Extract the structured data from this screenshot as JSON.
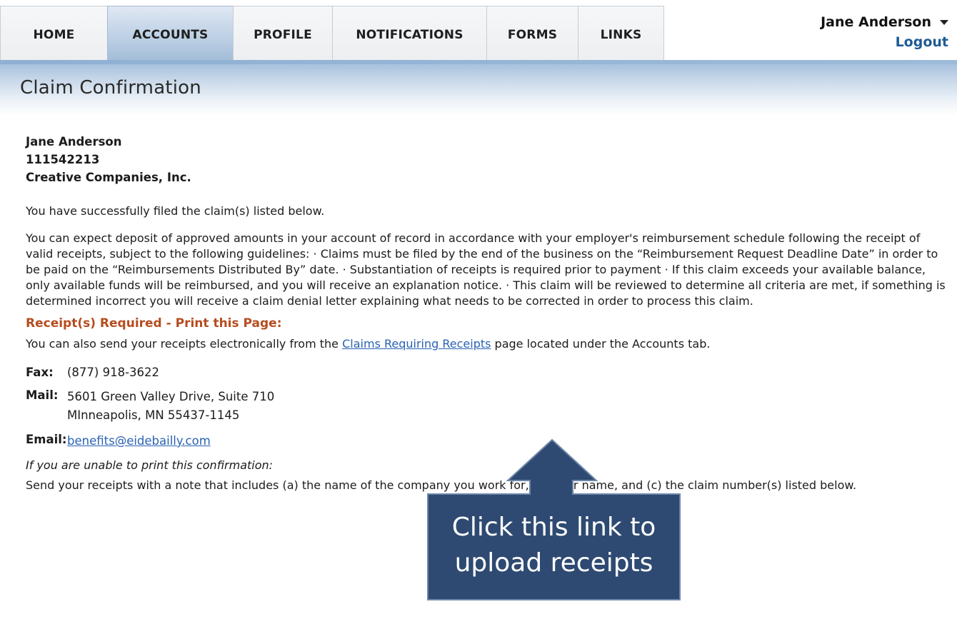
{
  "nav": {
    "tabs": [
      {
        "label": "HOME"
      },
      {
        "label": "ACCOUNTS",
        "active": true
      },
      {
        "label": "PROFILE"
      },
      {
        "label": "NOTIFICATIONS"
      },
      {
        "label": "FORMS"
      },
      {
        "label": "LINKS"
      }
    ],
    "user_name": "Jane Anderson",
    "logout_label": "Logout"
  },
  "page": {
    "title": "Claim Confirmation"
  },
  "participant": {
    "name": "Jane Anderson",
    "id": "111542213",
    "company": "Creative Companies, Inc."
  },
  "messages": {
    "success": "You have successfully filed the claim(s) listed below.",
    "guidelines": "You can expect deposit of approved amounts in your account of record in accordance with your employer's reimbursement schedule following the receipt of valid receipts, subject to the following guidelines: · Claims must be filed by the end of the business on the “Reimbursement Request Deadline Date” in order to be paid on the “Reimbursements Distributed By” date. · Substantiation of receipts is required prior to payment · If this claim exceeds your available balance, only available funds will be reimbursed, and you will receive an explanation notice. · This claim will be reviewed to determine all criteria are met, if something is determined incorrect you will receive a claim denial letter explaining what needs to be corrected in order to process this claim."
  },
  "receipts": {
    "heading": "Receipt(s) Required - Print this Page:",
    "electronic_prefix": "You can also send your receipts electronically from the ",
    "electronic_link": "Claims Requiring Receipts",
    "electronic_suffix": " page located under the Accounts tab."
  },
  "contact": {
    "fax_label": "Fax:",
    "fax_value": "(877) 918-3622",
    "mail_label": "Mail:",
    "mail_line1": "5601 Green Valley Drive, Suite 710",
    "mail_line2": "MInneapolis, MN  55437-1145",
    "email_label": "Email:",
    "email_value": "benefits@eidebailly.com"
  },
  "print_fallback": {
    "heading": "If you are unable to print this confirmation:",
    "text": "Send your receipts with a note that includes (a) the name of the company you work for, (b) your name, and (c) the claim number(s) listed below."
  },
  "callout": {
    "line1": "Click this link to",
    "line2": "upload receipts",
    "fill_color": "#2e4a72",
    "stroke_color": "#6f86a8"
  }
}
